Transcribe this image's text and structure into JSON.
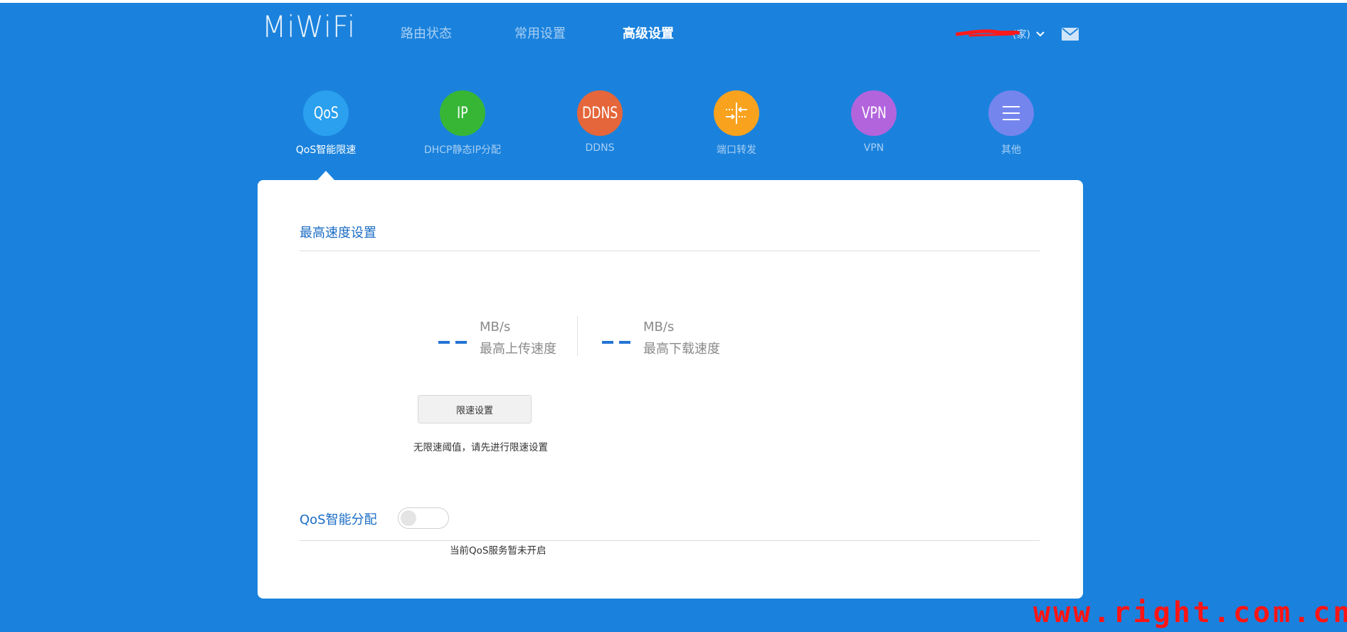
{
  "header": {
    "logo": "MiWiFi",
    "nav": [
      {
        "label": "路由状态",
        "active": false
      },
      {
        "label": "常用设置",
        "active": false
      },
      {
        "label": "高级设置",
        "active": true
      }
    ],
    "user_name": "(家)",
    "mail_icon": "mail-icon"
  },
  "features": [
    {
      "icon_text": "QoS",
      "label": "QoS智能限速",
      "color": "#2aa0ee",
      "active": true
    },
    {
      "icon_text": "IP",
      "label": "DHCP静态IP分配",
      "color": "#37b636",
      "active": false
    },
    {
      "icon_text": "DDNS",
      "label": "DDNS",
      "color": "#e5663a",
      "active": false
    },
    {
      "icon_text": "",
      "label": "端口转发",
      "color": "#f8a21e",
      "icon": "port-forward-icon",
      "active": false
    },
    {
      "icon_text": "VPN",
      "label": "VPN",
      "color": "#b264dd",
      "active": false
    },
    {
      "icon_text": "",
      "label": "其他",
      "color": "#7585ee",
      "icon": "menu-icon",
      "active": false
    }
  ],
  "panel": {
    "section_title": "最高速度设置",
    "upload": {
      "value": "- -",
      "unit": "MB/s",
      "label": "最高上传速度"
    },
    "download": {
      "value": "- -",
      "unit": "MB/s",
      "label": "最高下载速度"
    },
    "limit_button": "限速设置",
    "hint": "无限速阈值，请先进行限速设置",
    "qos_label": "QoS智能分配",
    "qos_enabled": false,
    "qos_status": "当前QoS服务暂未开启"
  },
  "watermark": "www.right.com.cn",
  "colors": {
    "background": "#1a82dd",
    "accent": "#2374d4",
    "section_title": "#1b6cc4"
  }
}
